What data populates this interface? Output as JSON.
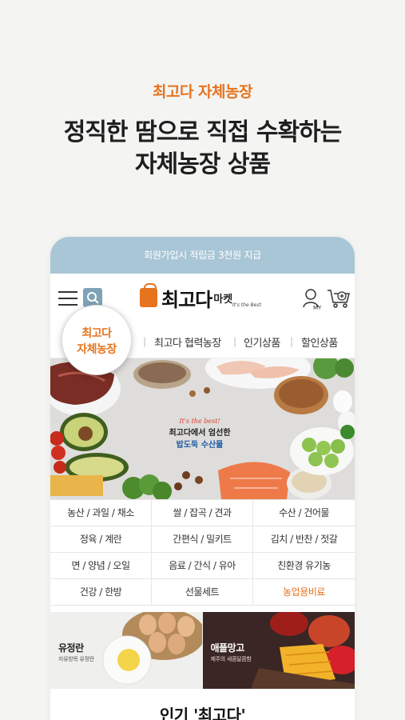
{
  "hero": {
    "tag": "최고다 자체농장",
    "line1": "정직한 땀으로 직접 수확하는",
    "line2": "자체농장 상품"
  },
  "app": {
    "topbar_text": "회원가입시 적립금 3천원 지급",
    "logo_main": "최고다",
    "logo_sub": "마켓",
    "logo_slogan": "It's the Best",
    "user_label": "MY",
    "icons": {
      "menu": "hamburger-icon",
      "search": "search-icon",
      "user": "user-icon",
      "cart": "cart-add-icon"
    },
    "colors": {
      "accent": "#e6731e",
      "topbar": "#a9c6d6",
      "search": "#7fa3b6",
      "banner_blue": "#1f5aa6"
    }
  },
  "nav": {
    "bubble_line1": "최고다",
    "bubble_line2": "자체농장",
    "items": [
      "최고다 협력농장",
      "인기상품",
      "할인상품"
    ],
    "separator": "|"
  },
  "banner": {
    "tag": "It's the best!",
    "line1": "최고다에서 엄선한",
    "line2": "밥도둑 수산물"
  },
  "categories": [
    "농산 / 과일 / 채소",
    "쌀 / 잡곡 / 견과",
    "수산 / 건어물",
    "정육 / 계란",
    "간편식 / 밀키트",
    "김치 / 반찬 / 젓갈",
    "면 / 양념 / 오일",
    "음료 / 간식 / 유아",
    "친환경 유기농",
    "건강 / 한방",
    "선물세트",
    "농업용비료"
  ],
  "promos": [
    {
      "title": "유정란",
      "subtitle": "자유방목 유정란"
    },
    {
      "title": "애플망고",
      "subtitle": "제주의 새콤달콤함"
    }
  ],
  "section_title": "인기 '최고다'"
}
